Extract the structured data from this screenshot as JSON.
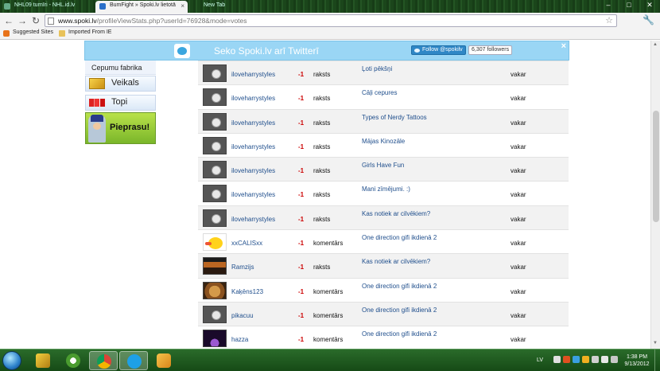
{
  "browser": {
    "tabs": [
      {
        "label": "NHL09 turnīri - NHL.id.lv",
        "active": false
      },
      {
        "label": "BumFight » Spoki.lv lietotā",
        "active": true
      },
      {
        "label": "New Tab",
        "active": false
      }
    ],
    "url_host": "www.spoki.lv",
    "url_path": "/profileViewStats.php?userId=76928&mode=votes",
    "bookmarks": [
      "Suggested Sites",
      "Imported From IE"
    ]
  },
  "twitter_bar": {
    "title": "Seko Spoki.lv arī Twitterī",
    "follow_label": "Follow @spokilv",
    "followers": "6,307 followers",
    "close": "×"
  },
  "sidebar": {
    "cepumu": "Cepumu fabrika",
    "veikals": "Veikals",
    "topi": "Topi",
    "pieprasu": "Pieprasu!"
  },
  "votes": [
    {
      "avatar": "default",
      "user": "iloveharrystyles",
      "score": "-1",
      "type": "raksts",
      "title": "Ļoti pēkšņi",
      "when": "vakar"
    },
    {
      "avatar": "default",
      "user": "iloveharrystyles",
      "score": "-1",
      "type": "raksts",
      "title": "Cāļi cepures",
      "when": "vakar"
    },
    {
      "avatar": "default",
      "user": "iloveharrystyles",
      "score": "-1",
      "type": "raksts",
      "title": "Types of Nerdy Tattoos",
      "when": "vakar"
    },
    {
      "avatar": "default",
      "user": "iloveharrystyles",
      "score": "-1",
      "type": "raksts",
      "title": "Mājas Kinozāle",
      "when": "vakar"
    },
    {
      "avatar": "default",
      "user": "iloveharrystyles",
      "score": "-1",
      "type": "raksts",
      "title": "Girls Have Fun",
      "when": "vakar"
    },
    {
      "avatar": "default",
      "user": "iloveharrystyles",
      "score": "-1",
      "type": "raksts",
      "title": "Mani zīmējumi. :)",
      "when": "vakar"
    },
    {
      "avatar": "default",
      "user": "iloveharrystyles",
      "score": "-1",
      "type": "raksts",
      "title": "Kas notiek ar cilvēkiem?",
      "when": "vakar"
    },
    {
      "avatar": "chick",
      "user": "xxCALISxx",
      "score": "-1",
      "type": "komentārs",
      "title": "One direction gifi ikdienā 2",
      "when": "vakar"
    },
    {
      "avatar": "movie",
      "user": "Ramzijs",
      "score": "-1",
      "type": "raksts",
      "title": "Kas notiek ar cilvēkiem?",
      "when": "vakar"
    },
    {
      "avatar": "cat",
      "user": "Kaķēns123",
      "score": "-1",
      "type": "komentārs",
      "title": "One direction gifi ikdienā 2",
      "when": "vakar"
    },
    {
      "avatar": "default",
      "user": "pikacuu",
      "score": "-1",
      "type": "komentārs",
      "title": "One direction gifi ikdienā 2",
      "when": "vakar"
    },
    {
      "avatar": "purple",
      "user": "hazza",
      "score": "-1",
      "type": "komentārs",
      "title": "One direction gifi ikdienā 2",
      "when": "vakar"
    }
  ],
  "taskbar": {
    "lang": "LV",
    "time": "1:38 PM",
    "date": "9/13/2012"
  }
}
